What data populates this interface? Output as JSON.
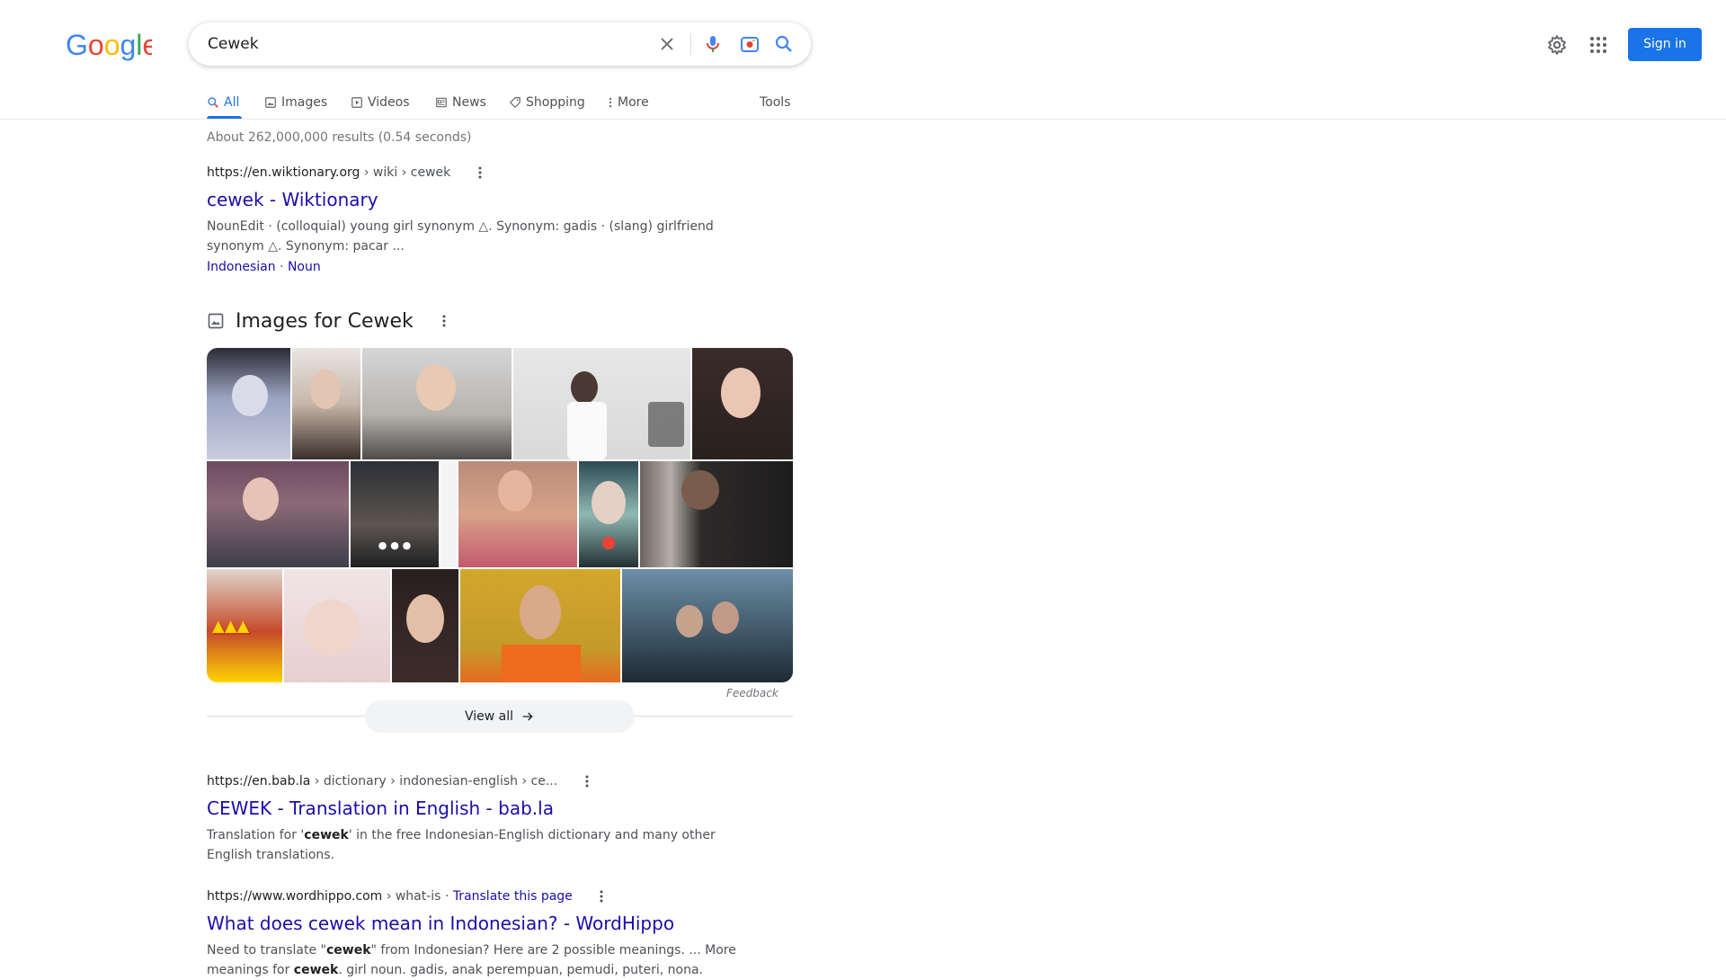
{
  "header": {
    "logo_text": "Google",
    "search_query": "Cewek",
    "sign_in_label": "Sign in"
  },
  "tabs": [
    {
      "label": "All",
      "icon": "search-icon",
      "active": true
    },
    {
      "label": "Images",
      "icon": "image-icon"
    },
    {
      "label": "Videos",
      "icon": "play-icon"
    },
    {
      "label": "News",
      "icon": "news-icon"
    },
    {
      "label": "Shopping",
      "icon": "tag-icon"
    },
    {
      "label": "More",
      "icon": "more-vert-icon"
    }
  ],
  "tools_label": "Tools",
  "stats": "About 262,000,000 results (0.54 seconds)",
  "results": [
    {
      "domain": "https://en.wiktionary.org",
      "path": " › wiki › cewek",
      "title": "cewek - Wiktionary",
      "snippet_line1": "NounEdit · (colloquial) young girl synonym △. Synonym: gadis · (slang) girlfriend",
      "snippet_line2": "synonym △. Synonym: pacar ...",
      "sublinks": [
        "Indonesian",
        "Noun"
      ]
    },
    {
      "domain": "https://en.bab.la",
      "path": " › dictionary › indonesian-english › ce...",
      "title": "CEWEK - Translation in English - bab.la",
      "snippet_pre": "Translation for '",
      "snippet_bold": "cewek",
      "snippet_post": "' in the free Indonesian-English dictionary and many other",
      "snippet_line2": "English translations."
    },
    {
      "domain": "https://www.wordhippo.com",
      "path": " › what-is · ",
      "translate": "Translate this page",
      "title": "What does cewek mean in Indonesian? - WordHippo",
      "snippet_pre": "Need to translate \"",
      "snippet_bold": "cewek",
      "snippet_post": "\" from Indonesian? Here are 2 possible meanings. ... More",
      "snippet_line2_pre": "meanings for ",
      "snippet_line2_bold": "cewek",
      "snippet_line2_post": ". girl noun. gadis, anak perempuan, pemudi, puteri, nona."
    }
  ],
  "images_block": {
    "title": "Images for Cewek",
    "feedback": "Feedback",
    "view_all": "View all"
  },
  "colors": {
    "accent": "#1a73e8",
    "link": "#1a0dab",
    "snippet": "#4d5156"
  }
}
